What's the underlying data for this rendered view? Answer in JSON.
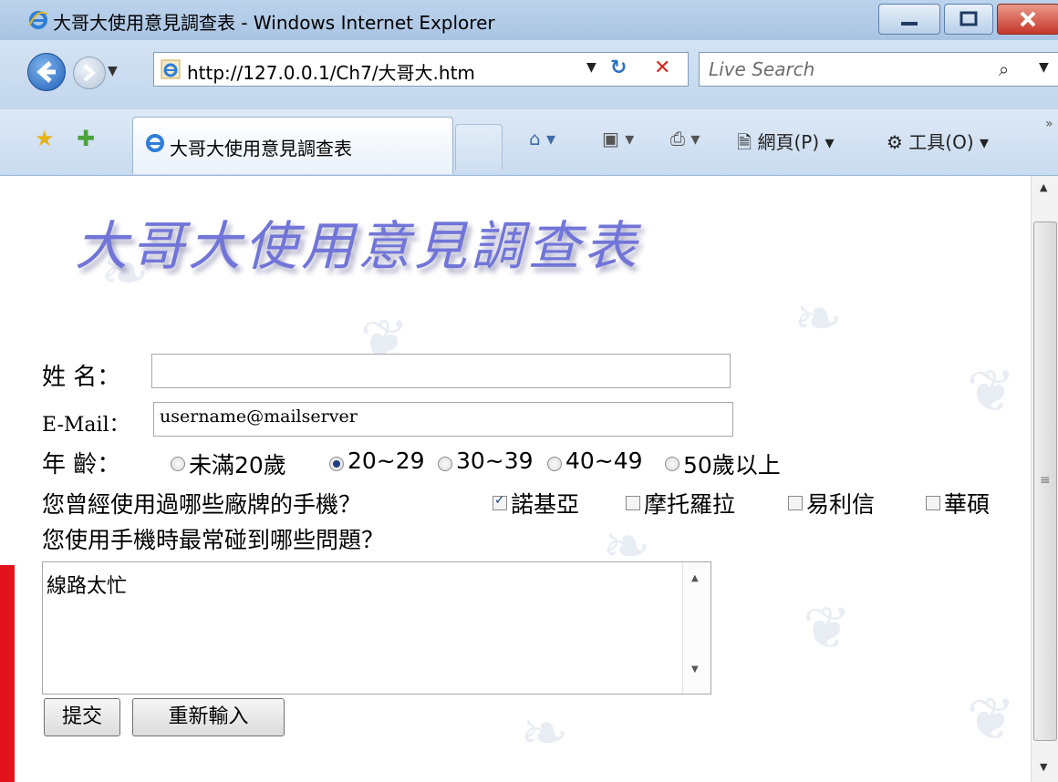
{
  "window": {
    "title": "大哥大使用意見調查表 - Windows Internet Explorer",
    "icon": "ie-icon",
    "controls": [
      "minimize-icon",
      "maximize-icon",
      "close-icon"
    ]
  },
  "navigation": {
    "address_url": "http://127.0.0.1/Ch7/大哥大.htm",
    "search_placeholder": "Live Search"
  },
  "toolbar": {
    "tab_title": "大哥大使用意見調查表",
    "page_label": "網頁(P)",
    "tools_label": "工具(O)"
  },
  "form": {
    "heading": "大哥大使用意見調查表",
    "name_label": "姓 名：",
    "name_value": "",
    "email_label": "E-Mail：",
    "email_value": "username@mailserver",
    "age_label": "年 齡：",
    "age_options": [
      {
        "label": "未滿20歲",
        "selected": false
      },
      {
        "label": "20~29",
        "selected": true
      },
      {
        "label": "30~39",
        "selected": false
      },
      {
        "label": "40~49",
        "selected": false
      },
      {
        "label": "50歲以上",
        "selected": false
      }
    ],
    "brands_question": "您曾經使用過哪些廠牌的手機？",
    "brand_options": [
      {
        "label": "諾基亞",
        "checked": true
      },
      {
        "label": "摩托羅拉",
        "checked": false
      },
      {
        "label": "易利信",
        "checked": false
      },
      {
        "label": "華碩",
        "checked": false
      }
    ],
    "problems_question": "您使用手機時最常碰到哪些問題？",
    "problems_value": "線路太忙",
    "submit_label": "提交",
    "reset_label": "重新輸入"
  },
  "colors": {
    "heading": "#7175d8",
    "accent_left": "#e3131b"
  }
}
